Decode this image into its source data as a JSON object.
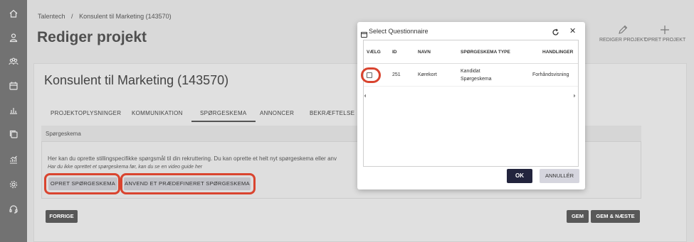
{
  "breadcrumb": {
    "root": "Talentech",
    "separator": "/",
    "current": "Konsulent til Marketing (143570)"
  },
  "page": {
    "title": "Rediger projekt"
  },
  "top_actions": {
    "edit_label": "REDIGER PROJEKT",
    "create_label": "OPRET PROJEKT"
  },
  "sidebar": {
    "icons": [
      "home-icon",
      "user-icon",
      "users-icon",
      "calendar-icon",
      "bar-chart-icon",
      "copy-icon",
      "analytics-icon",
      "gear-icon",
      "support-icon"
    ]
  },
  "project": {
    "title": "Konsulent til Marketing (143570)"
  },
  "tabs": [
    {
      "label": "PROJEKTOPLYSNINGER"
    },
    {
      "label": "KOMMUNIKATION"
    },
    {
      "label": "SPØRGESKEMA"
    },
    {
      "label": "ANNONCER"
    },
    {
      "label": "BEKRÆFTELSE"
    }
  ],
  "panel": {
    "heading": "Spørgeskema",
    "text": "Her kan du oprette stillingspecifikke spørgsmål til din rekruttering. Du kan oprette et helt nyt spørgeskema eller anv",
    "italic": "Har du ikke oprettet et spørgeskema før, kan du se en video guide her",
    "create_button": "OPRET SPØRGESKEMA",
    "apply_button": "ANVEND ET PRÆDEFINERET SPØRGESKEMA"
  },
  "footer": {
    "back_button": "FORRIGE",
    "save_button": "GEM",
    "save_next_button": "GEM & NÆSTE"
  },
  "modal": {
    "title": "Select Questionnaire",
    "columns": [
      "VÆLG",
      "ID",
      "NAVN",
      "SPØRGESKEMA TYPE",
      "HANDLINGER"
    ],
    "rows": [
      {
        "id": "251",
        "name": "Kørekort",
        "type_line1": "Kandidat",
        "type_line2": "Spørgeskema",
        "action": "Forhåndsvisning"
      }
    ],
    "ok_button": "OK",
    "cancel_button": "ANNULLÉR"
  },
  "colors": {
    "highlight": "#d9442f",
    "ok_button": "#22243d",
    "sidebar": "#727272"
  }
}
